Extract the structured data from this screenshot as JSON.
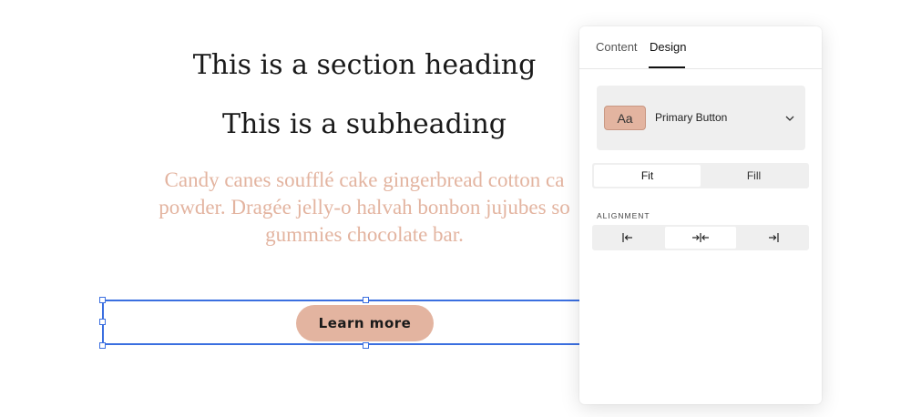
{
  "page": {
    "heading": "This is a section heading",
    "subheading": "This is a subheading",
    "body_lines": [
      "Candy canes soufflé cake gingerbread cotton ca",
      "powder. Dragée jelly-o halvah bonbon jujubes so",
      "gummies chocolate bar."
    ],
    "button_label": "Learn more"
  },
  "panel": {
    "tabs": [
      {
        "label": "Content",
        "active": false
      },
      {
        "label": "Design",
        "active": true
      }
    ],
    "button_style": {
      "chip_text": "Aa",
      "label": "Primary Button",
      "icon": "chevron-down-icon"
    },
    "width_mode": {
      "options": [
        "Fit",
        "Fill"
      ],
      "selected": "Fit"
    },
    "alignment": {
      "label": "ALIGNMENT",
      "options": [
        "align-left-icon",
        "align-center-icon",
        "align-right-icon"
      ],
      "selected": "align-center-icon"
    }
  },
  "colors": {
    "accent": "#e3b4a0",
    "selection": "#3b6fe0",
    "text": "#1a1a1a"
  }
}
